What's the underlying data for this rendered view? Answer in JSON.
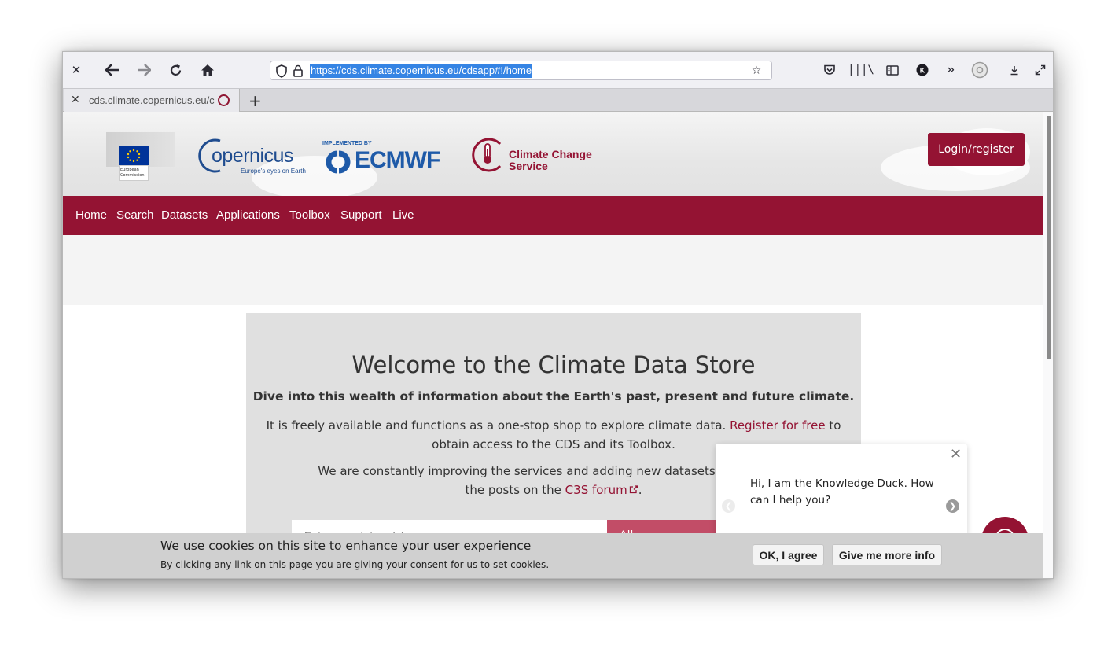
{
  "browser": {
    "url": "https://cds.climate.copernicus.eu/cdsapp#!/home",
    "tab_title": "cds.climate.copernicus.eu/c",
    "icons": [
      "close-icon",
      "back-icon",
      "forward-icon",
      "reload-icon",
      "home-icon",
      "shield-icon",
      "lock-icon",
      "bookmark-star-icon",
      "pocket-icon",
      "library-icon",
      "sidebar-icon",
      "account-icon",
      "overflow-icon",
      "extension-icon",
      "download-icon",
      "fullscreen-icon",
      "new-tab-icon"
    ]
  },
  "header": {
    "eu_logo_line1": "European",
    "eu_logo_line2": "Commission",
    "copernicus_logo": "opernicus",
    "copernicus_tagline": "Europe's eyes on Earth",
    "ecmwf_small": "IMPLEMENTED BY",
    "ecmwf_logo": "ECMWF",
    "c3s_line1": "Climate Change",
    "c3s_line2": "Service",
    "login_label": "Login/register"
  },
  "nav": {
    "items": [
      "Home",
      "Search",
      "Datasets",
      "Applications",
      "Toolbox",
      "Support",
      "Live"
    ]
  },
  "welcome": {
    "title": "Welcome to the Climate Data Store",
    "subtitle": "Dive into this wealth of information about the Earth's past, present and future climate.",
    "p1_a": "It is freely available and functions as a one-stop shop to explore climate data. ",
    "p1_link": "Register for free",
    "p1_b": " to obtain access to the CDS and its Toolbox.",
    "p2_a": "We are constantly improving the services and adding new datasets. For latest a",
    "p2_b": "the posts on the ",
    "p2_link": "C3S forum",
    "p2_c": ".",
    "search_placeholder": "Enter search term(s)",
    "search_select": "All"
  },
  "cookie": {
    "heading": "We use cookies on this site to enhance your user experience",
    "text": "By clicking any link on this page you are giving your consent for us to set cookies.",
    "agree_label": "OK, I agree",
    "info_label": "Give me more info"
  },
  "chat": {
    "message": "Hi, I am the Knowledge Duck. How can I help you?"
  },
  "colors": {
    "brand": "#941333",
    "ecmwf_blue": "#1e5aa8",
    "copernicus_blue": "#1f4c8f",
    "url_highlight": "#3584e4"
  }
}
